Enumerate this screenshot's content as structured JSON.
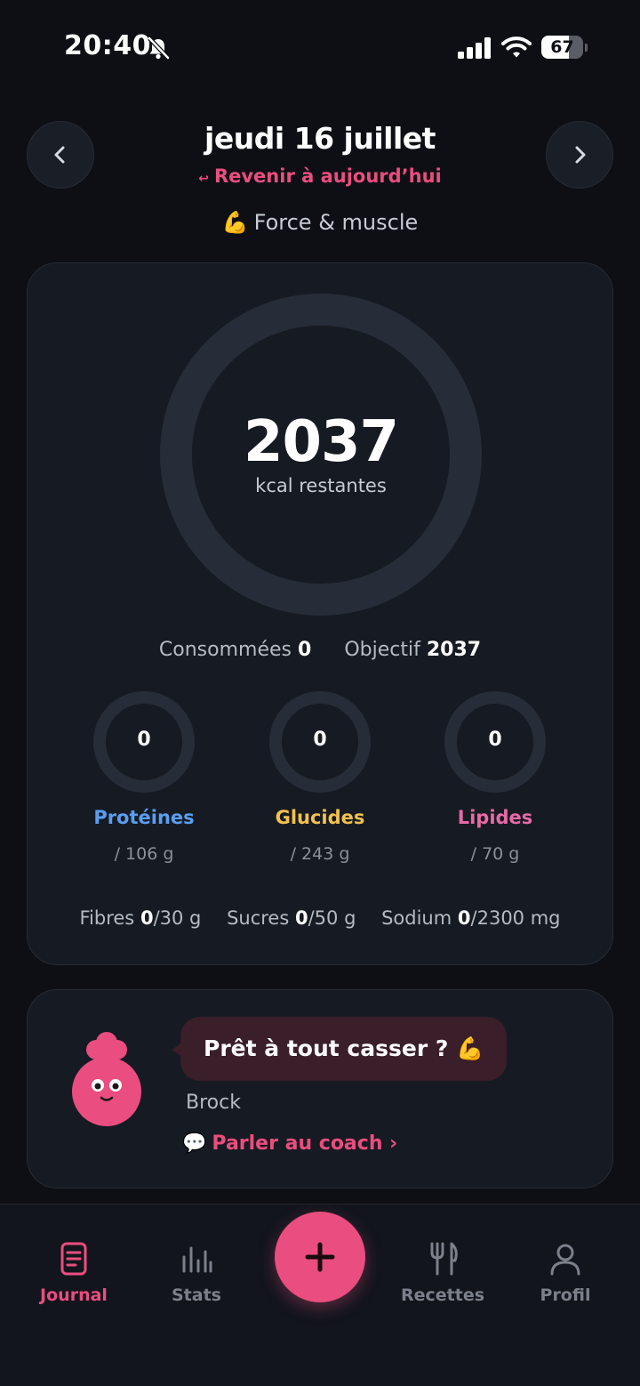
{
  "status_bar": {
    "time": "20:40",
    "battery_level": "67",
    "battery_fraction": 0.67
  },
  "header": {
    "date_title": "jeudi 16 juillet",
    "back_today_arrow": "↩",
    "back_today_label": "Revenir à aujourd’hui",
    "goal_emoji": "💪",
    "goal_label": "Force & muscle"
  },
  "calories": {
    "remaining_value": "2037",
    "remaining_label": "kcal restantes",
    "progress": 0,
    "consumed_label": "Consommées",
    "consumed_value": "0",
    "goal_label": "Objectif",
    "goal_value": "2037"
  },
  "macros": [
    {
      "value": "0",
      "name": "Protéines",
      "target": "/ 106 g",
      "color": "#5a9ef0",
      "progress": 0
    },
    {
      "value": "0",
      "name": "Glucides",
      "target": "/ 243 g",
      "color": "#f2c14e",
      "progress": 0
    },
    {
      "value": "0",
      "name": "Lipides",
      "target": "/ 70 g",
      "color": "#e86aa7",
      "progress": 0
    }
  ],
  "micros": [
    {
      "name": "Fibres",
      "value": "0",
      "target": "/30 g"
    },
    {
      "name": "Sucres",
      "value": "0",
      "target": "/50 g"
    },
    {
      "name": "Sodium",
      "value": "0",
      "target": "/2300 mg"
    }
  ],
  "coach": {
    "message": "Prêt à tout casser ? 💪",
    "name": "Brock",
    "link_emoji": "💬",
    "link_label": "Parler au coach ›"
  },
  "tabs": [
    {
      "label": "Journal",
      "icon": "journal-icon",
      "active": true
    },
    {
      "label": "Stats",
      "icon": "stats-icon",
      "active": false
    },
    {
      "label": "Recettes",
      "icon": "fork-knife-icon",
      "active": false
    },
    {
      "label": "Profil",
      "icon": "person-icon",
      "active": false
    }
  ],
  "colors": {
    "accent": "#ea4d7f",
    "background": "#0d0f14",
    "card": "#161a22",
    "ring_track": "#262c38"
  }
}
